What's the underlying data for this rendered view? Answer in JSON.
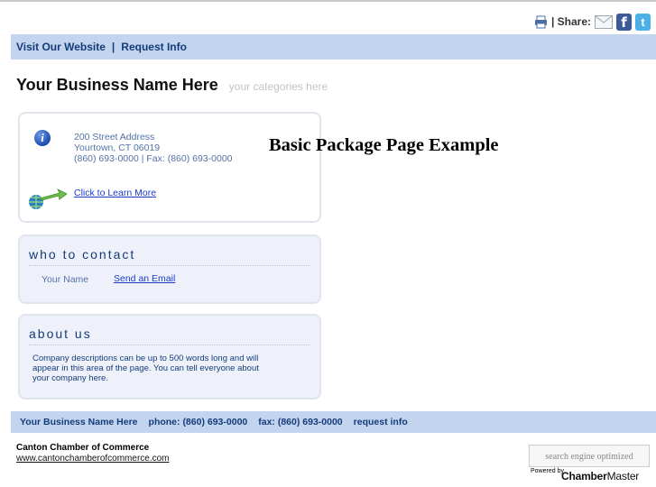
{
  "share": {
    "label": "| Share:",
    "icons": [
      "printer-icon",
      "mail-icon",
      "facebook-icon",
      "twitter-icon"
    ],
    "facebook_glyph": "f",
    "twitter_glyph": "t"
  },
  "nav": {
    "website_link": "Visit Our Website",
    "separator": "|",
    "request_link": "Request Info"
  },
  "business": {
    "name": "Your Business Name Here",
    "categories": "your categories here"
  },
  "address_card": {
    "street": "200 Street Address",
    "city_line": "Yourtown, CT  06019",
    "phone_line": "(860) 693-0000 | Fax: (860) 693-0000",
    "learn_more": "Click to Learn More"
  },
  "contact_card": {
    "heading": "who to contact",
    "name": "Your Name",
    "email_link": "Send an Email"
  },
  "about_card": {
    "heading": "about us",
    "text": "Company descriptions can be up to 500 words long and will appear in this area of the page.  You can tell everyone about your company here."
  },
  "overlay": {
    "heading": "Basic Package Page Example"
  },
  "footer_bar": {
    "name": "Your Business Name Here",
    "phone": "phone: (860) 693-0000",
    "fax": "fax: (860) 693-0000",
    "request": "request info"
  },
  "chamber": {
    "name": "Canton Chamber of Commerce",
    "url": "www.cantonchamberofcommerce.com"
  },
  "badge": {
    "seo": "search engine optimized",
    "powered_by": "Powered by",
    "brand_a": "Chamber",
    "brand_b": "Master"
  },
  "colors": {
    "nav_bg": "#c2d4ee",
    "nav_text": "#143c7a",
    "card_bg": "#eef1fa",
    "link": "#1a3cc7"
  }
}
